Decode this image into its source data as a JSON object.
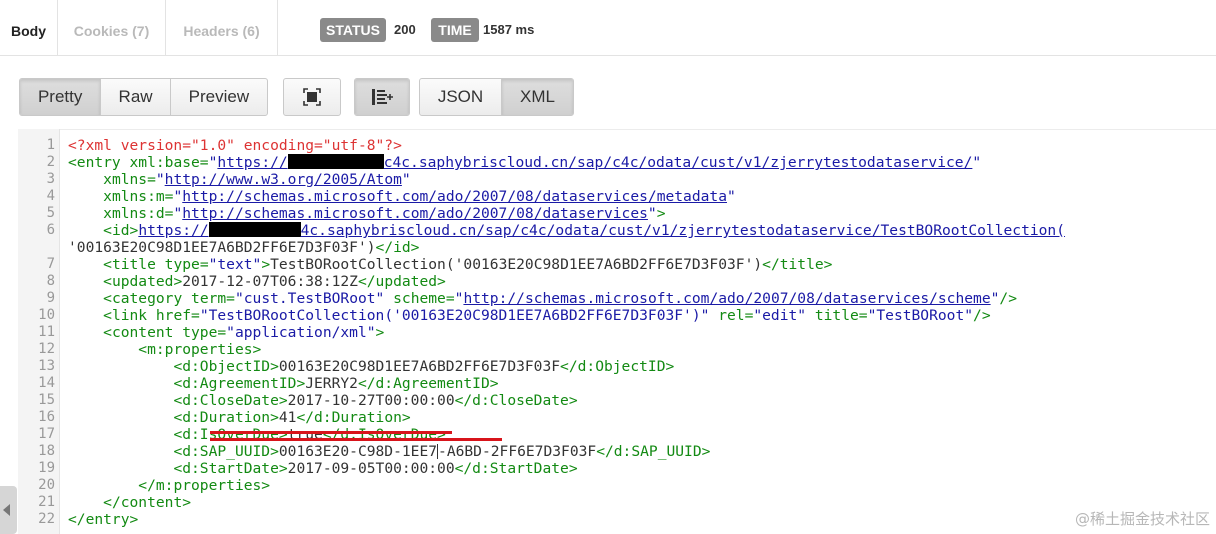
{
  "tabs": {
    "body": "Body",
    "cookies": "Cookies (7)",
    "headers": "Headers (6)"
  },
  "response": {
    "status_label": "STATUS",
    "status_value": "200",
    "time_label": "TIME",
    "time_value": "1587 ms"
  },
  "toolbar": {
    "pretty": "Pretty",
    "raw": "Raw",
    "preview": "Preview",
    "expand_icon": "expand-icon",
    "wrap_icon": "wrap-lines-icon",
    "json": "JSON",
    "xml": "XML"
  },
  "code": {
    "line_numbers": [
      "1",
      "2",
      "3",
      "4",
      "5",
      "6",
      "",
      "7",
      "8",
      "9",
      "10",
      "11",
      "12",
      "13",
      "14",
      "15",
      "16",
      "17",
      "18",
      "19",
      "20",
      "21",
      "22"
    ],
    "l1": "<?xml version=\"1.0\" encoding=\"utf-8\"?>",
    "l2_url_a": "https://",
    "l2_url_b": "c4c.saphybriscloud.cn/sap/c4c/odata/cust/v1/zjerrytestodataservice/",
    "l3_url": "http://www.w3.org/2005/Atom",
    "l4_url": "http://schemas.microsoft.com/ado/2007/08/dataservices/metadata",
    "l5_url": "http://schemas.microsoft.com/ado/2007/08/dataservices",
    "l6_url_a": "https://",
    "l6_url_b": "4c.saphybriscloud.cn/sap/c4c/odata/cust/v1/zjerrytestodataservice/TestBORootCollection(",
    "l6b": "'00163E20C98D1EE7A6BD2FF6E7D3F03F')",
    "l7_type": "\"text\"",
    "l7_text": "TestBORootCollection('00163E20C98D1EE7A6BD2FF6E7D3F03F')",
    "l8_text": "2017-12-07T06:38:12Z",
    "l9_term": "\"cust.TestBORoot\"",
    "l9_scheme": "http://schemas.microsoft.com/ado/2007/08/dataservices/scheme",
    "l10_href": "\"TestBORootCollection('00163E20C98D1EE7A6BD2FF6E7D3F03F')\"",
    "l10_rel": "\"edit\"",
    "l10_title": "\"TestBORoot\"",
    "l11_type": "\"application/xml\"",
    "l13_text": "00163E20C98D1EE7A6BD2FF6E7D3F03F",
    "l14_text": "JERRY2",
    "l15_text": "2017-10-27T00:00:00",
    "l16_text": "41",
    "l17_text": "true",
    "l18_text_a": "00163E20-C98D-1EE7",
    "l18_text_b": "-A6BD-2FF6E7D3F03F",
    "l19_text": "2017-09-05T00:00:00"
  },
  "watermark": "@稀土掘金技术社区"
}
